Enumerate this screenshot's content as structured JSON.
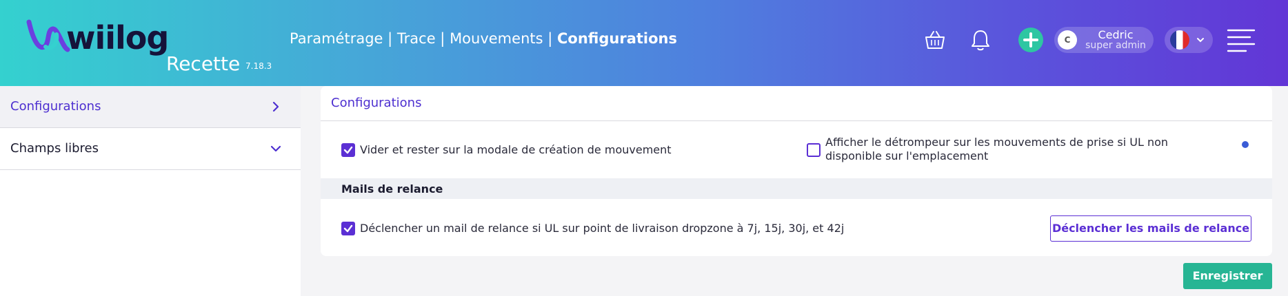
{
  "header": {
    "logo_text": "wiilog",
    "environment": "Recette",
    "version": "7.18.3",
    "breadcrumb": {
      "parts": [
        "Paramétrage",
        "Trace",
        "Mouvements"
      ],
      "separator": " | ",
      "current": "Configurations"
    },
    "icons": [
      "basket-icon",
      "bell-icon",
      "plus-icon",
      "chevron-down-icon",
      "menu-icon"
    ],
    "user": {
      "initial": "C",
      "name": "Cedric",
      "role": "super admin"
    },
    "language_flag": "fr-flag-icon"
  },
  "sidebar": {
    "items": [
      {
        "label": "Configurations",
        "icon": "chevron-right-icon",
        "active": true
      },
      {
        "label": "Champs libres",
        "icon": "chevron-down-icon",
        "active": false
      }
    ]
  },
  "card": {
    "title": "Configurations",
    "options": [
      {
        "label": "Vider et rester sur la modale de création de mouvement",
        "checked": true
      },
      {
        "label": "Afficher le détrompeur sur les mouvements de prise si UL non disponible sur l'emplacement",
        "checked": false,
        "info_icon": "info-icon"
      }
    ],
    "section": {
      "title": "Mails de relance",
      "option": {
        "label": "Déclencher un mail de relance si UL sur point de livraison dropzone à 7j, 15j, 30j, et 42j",
        "checked": true
      },
      "button_label": "Déclencher les mails de relance"
    }
  },
  "save_label": "Enregistrer",
  "colors": {
    "accent": "#5b2fd4",
    "success": "#27b594",
    "header_gradient": [
      "#34d1cf",
      "#6236d6"
    ]
  }
}
